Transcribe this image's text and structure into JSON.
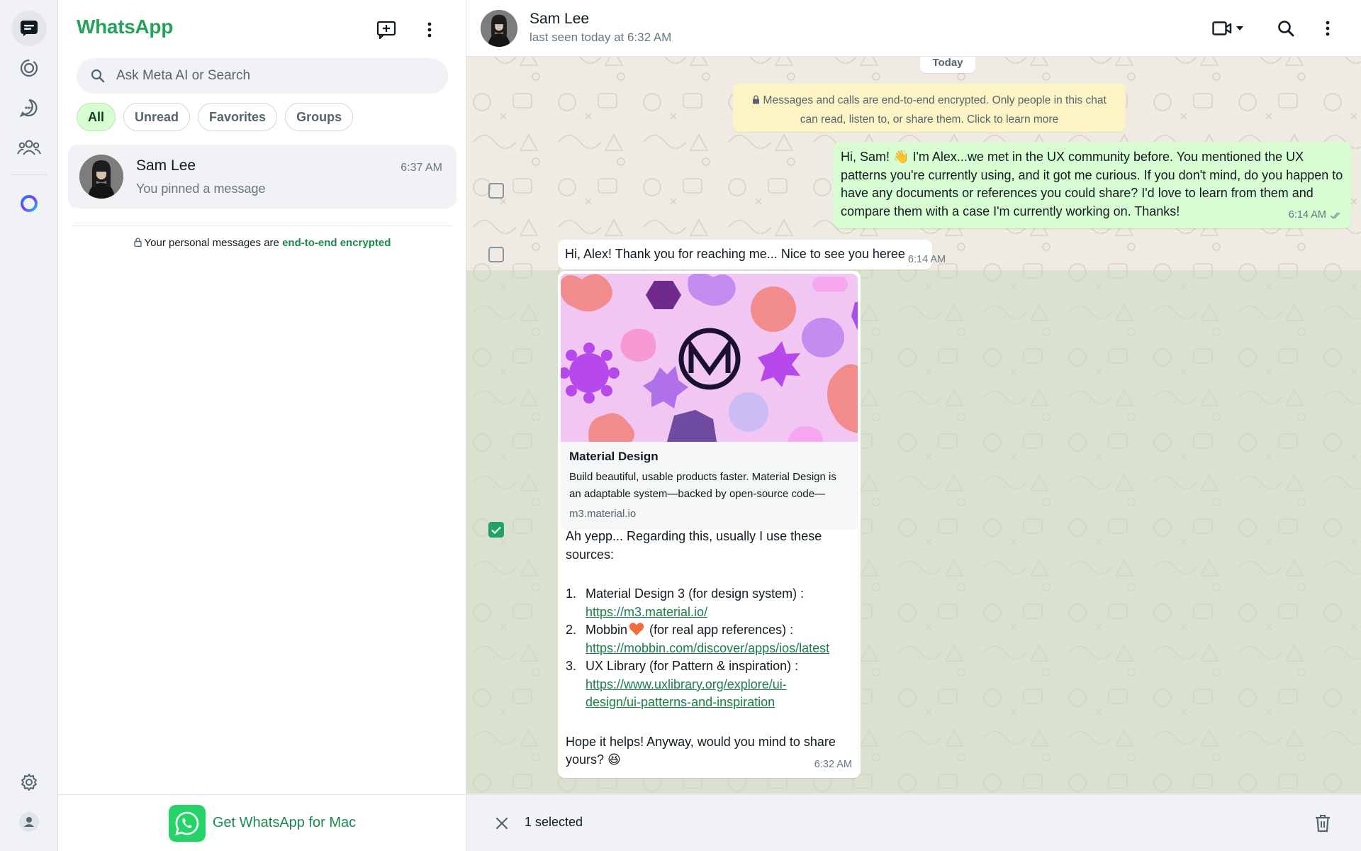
{
  "app": {
    "brand": "WhatsApp"
  },
  "rail": {
    "items": [
      "chats-icon",
      "status-icon",
      "channels-icon",
      "communities-icon",
      "meta-ai-icon"
    ],
    "bottom": [
      "settings-icon",
      "profile-icon"
    ]
  },
  "list": {
    "search_placeholder": "Ask Meta AI or Search",
    "filters": [
      "All",
      "Unread",
      "Favorites",
      "Groups"
    ],
    "active_filter": "All",
    "chats": [
      {
        "name": "Sam Lee",
        "time": "6:37 AM",
        "preview": "You pinned a message"
      }
    ],
    "e2e_prefix": "Your personal messages are ",
    "e2e_link": "end-to-end encrypted",
    "footer": "Get WhatsApp for Mac"
  },
  "chat": {
    "contact_name": "Sam Lee",
    "status": "last seen today at 6:32 AM",
    "day_label": "Today",
    "system_note": "Messages and calls are end-to-end encrypted. Only people in this chat can read, listen to, or share them. Click to learn more",
    "messages": [
      {
        "direction": "out",
        "text_a": "Hi, Sam! ",
        "text_b": " I'm Alex...we met in the UX community before. You mentioned the UX patterns you're currently using, and it got me curious. If you don't mind, do you happen to have any documents or references you could share? I'd love to learn from them and compare them with a case I'm currently working on. Thanks!",
        "emoji": "👋",
        "time": "6:14 AM",
        "selected": false
      },
      {
        "direction": "in",
        "text": "Hi, Alex! Thank you for reaching me... Nice to see you heree",
        "time": "6:14 AM",
        "selected": false
      },
      {
        "direction": "in",
        "selected": true,
        "link_preview": {
          "title": "Material Design",
          "description": "Build beautiful, usable products faster. Material Design is an adaptable system—backed by open-source code—",
          "domain": "m3.material.io"
        },
        "intro": "Ah yepp... Regarding this, usually I use these sources:",
        "list": [
          {
            "num": "1.",
            "label": "Material Design 3 (for design system) :",
            "url": "https://m3.material.io/"
          },
          {
            "num": "2.",
            "label_a": "Mobbin",
            "label_b": " (for real app references) :",
            "url": "https://mobbin.com/discover/apps/ios/latest"
          },
          {
            "num": "3.",
            "label": "UX Library (for Pattern & inspiration) :",
            "url_a": "https://www.uxlibrary.org/explore/ui-",
            "url_b": "design/ui-patterns-and-inspiration"
          }
        ],
        "outro": "Hope it helps! Anyway, would you mind to share yours?",
        "outro_emoji": "😆",
        "time": "6:32 AM"
      }
    ],
    "selection": {
      "count_label": "1 selected"
    }
  },
  "colors": {
    "brand_green": "#25a35a",
    "outgoing_bubble": "#d9fdd3",
    "chat_background": "#efeae2",
    "check_green": "#21a366"
  }
}
